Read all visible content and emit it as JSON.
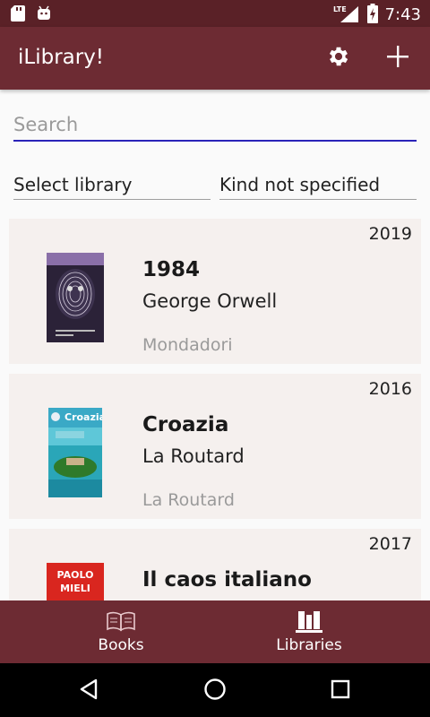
{
  "status_bar": {
    "time": "7:43",
    "network": "LTE",
    "icons": [
      "sd-card-icon",
      "android-icon",
      "lte-signal-icon",
      "battery-charging-icon"
    ]
  },
  "app_bar": {
    "title": "iLibrary!",
    "settings_icon": "gear-icon",
    "add_icon": "plus-icon"
  },
  "search": {
    "placeholder": "Search",
    "value": ""
  },
  "filters": {
    "library": "Select library",
    "kind": "Kind not specified"
  },
  "books": [
    {
      "year": "2019",
      "title": "1984",
      "author": "George Orwell",
      "publisher": "Mondadori",
      "cover_text": "GEORGE ORWELL 1984"
    },
    {
      "year": "2016",
      "title": "Croazia",
      "author": "La Routard",
      "publisher": "La Routard",
      "cover_text": "Croazia"
    },
    {
      "year": "2017",
      "title": "Il caos italiano",
      "author": "",
      "publisher": "",
      "cover_text": "PAOLO MIELI"
    }
  ],
  "bottom_nav": {
    "books_label": "Books",
    "libraries_label": "Libraries"
  },
  "colors": {
    "primary": "#6d2b33",
    "status_bar": "#5a2127",
    "card_bg": "#f5f0ee",
    "search_underline": "#2a23b8"
  }
}
